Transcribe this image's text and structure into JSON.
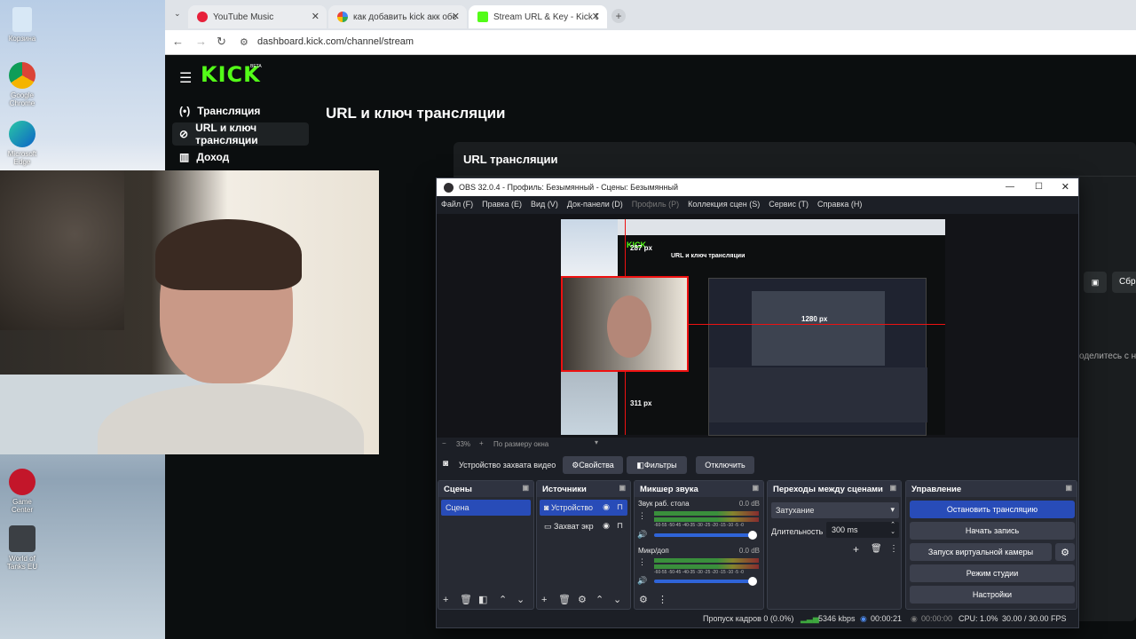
{
  "desktop": {
    "icons": [
      "Корзина",
      "Google Chrome",
      "Microsoft Edge",
      "Game Center",
      "World of Tanks EU"
    ]
  },
  "browser": {
    "tabs": [
      {
        "label": "YouTube Music"
      },
      {
        "label": "как добавить kick акк обс - Go"
      },
      {
        "label": "Stream URL & Key - Kick Dashb"
      }
    ],
    "address": "dashboard.kick.com/channel/stream"
  },
  "kick": {
    "logo": "KICK",
    "logo_badge": "BETA",
    "nav": [
      "Трансляция",
      "URL и ключ трансляции",
      "Доход"
    ],
    "page_title": "URL и ключ трансляции",
    "card_title": "URL трансляции",
    "right_button_text": "Сбр",
    "right_partial_text": "оделитесь с наш"
  },
  "obs": {
    "title": "OBS 32.0.4 - Профиль: Безымянный - Сцены: Безымянный",
    "menu": [
      "Файл (F)",
      "Правка (E)",
      "Вид (V)",
      "Док-панели (D)",
      "Профиль (P)",
      "Коллекция сцен (S)",
      "Сервис (T)",
      "Справка (H)"
    ],
    "preview": {
      "label_top": "287 px",
      "label_mid": "1280 px",
      "label_bottom": "311 px",
      "inner_title": "URL и ключ трансляции",
      "zoom": "33%",
      "fit": "По размеру окна"
    },
    "source_bar": {
      "source": "Устройство захвата видео",
      "props": "Свойства",
      "filters": "Фильтры",
      "disable": "Отключить"
    },
    "scenes": {
      "title": "Сцены",
      "items": [
        "Сцена"
      ]
    },
    "sources": {
      "title": "Источники",
      "items": [
        "Устройство",
        "Захват экр"
      ]
    },
    "mixer": {
      "title": "Микшер звука",
      "channels": [
        {
          "name": "Звук раб. стола",
          "db": "0.0 dB"
        },
        {
          "name": "Микр/доп",
          "db": "0.0 dB"
        }
      ],
      "scale": "-60-55 -50-45 -40-35 -30 -25 -20 -15 -10 -5 -0"
    },
    "transitions": {
      "title": "Переходы между сценами",
      "type": "Затухание",
      "duration_label": "Длительность",
      "duration": "300 ms"
    },
    "controls": {
      "title": "Управление",
      "buttons": [
        "Остановить трансляцию",
        "Начать запись",
        "Запуск виртуальной камеры",
        "Режим студии",
        "Настройки"
      ]
    },
    "status": {
      "dropped": "Пропуск кадров 0 (0.0%)",
      "bitrate": "5346 kbps",
      "stream_time": "00:00:21",
      "rec_time": "00:00:00",
      "cpu": "CPU: 1.0%",
      "fps": "30.00 / 30.00 FPS"
    }
  }
}
